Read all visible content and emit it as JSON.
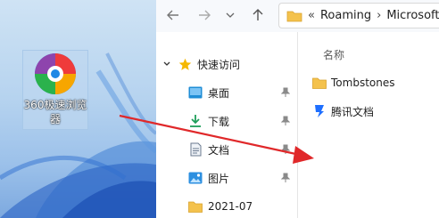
{
  "desktop": {
    "icon_label": "360极速浏览器"
  },
  "toolbar": {
    "back_icon": "arrow-left-icon",
    "forward_icon": "arrow-right-icon",
    "history_icon": "chevron-down-icon",
    "up_icon": "arrow-up-icon"
  },
  "address": {
    "overflow": "«",
    "crumbs": [
      "Roaming",
      "Microsoft"
    ],
    "separator": "›"
  },
  "nav": {
    "quick_access": "快速访问",
    "items": [
      {
        "label": "桌面",
        "icon": "desktop-icon",
        "pinned": true
      },
      {
        "label": "下载",
        "icon": "download-icon",
        "pinned": true
      },
      {
        "label": "文档",
        "icon": "document-icon",
        "pinned": true
      },
      {
        "label": "图片",
        "icon": "picture-icon",
        "pinned": true
      },
      {
        "label": "2021-07",
        "icon": "folder-icon",
        "pinned": false
      }
    ]
  },
  "content": {
    "column_name": "名称",
    "files": [
      {
        "name": "Tombstones",
        "icon": "folder-icon"
      },
      {
        "name": "腾讯文档",
        "icon": "tencent-docs-icon"
      }
    ]
  },
  "colors": {
    "folder": "#f4c24d",
    "accent": "#0067c0",
    "arrow": "#e0282a"
  }
}
